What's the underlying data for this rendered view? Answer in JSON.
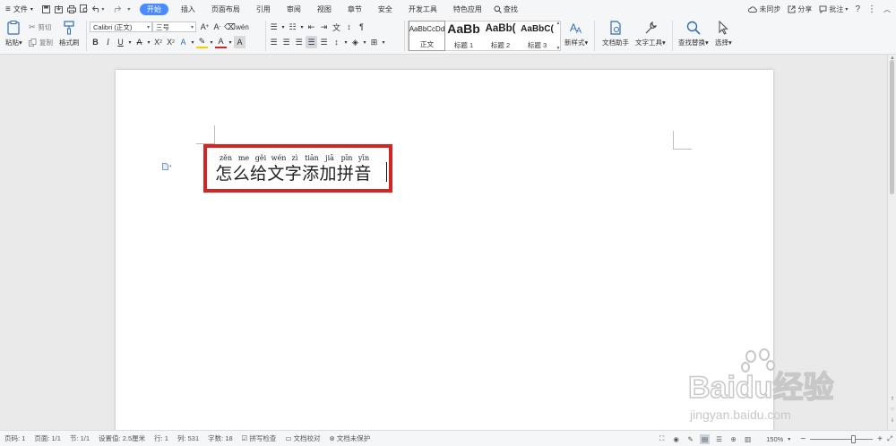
{
  "menubar": {
    "file_label": "文件",
    "tabs": [
      "开始",
      "插入",
      "页面布局",
      "引用",
      "审阅",
      "视图",
      "章节",
      "安全",
      "开发工具",
      "特色应用"
    ],
    "search_label": "查找",
    "sync_label": "未同步",
    "share_label": "分享",
    "comment_label": "批注",
    "help_label": "?"
  },
  "ribbon": {
    "paste_label": "粘贴",
    "cut_label": "剪切",
    "copy_label": "复制",
    "format_painter_label": "格式刷",
    "font_name": "Calibri (正文)",
    "font_size": "三号",
    "styles": [
      {
        "preview": "AaBbCcDd",
        "name": "正文"
      },
      {
        "preview": "AaBb",
        "name": "标题 1"
      },
      {
        "preview": "AaBb(",
        "name": "标题 2"
      },
      {
        "preview": "AaBbC(",
        "name": "标题 3"
      }
    ],
    "new_style_label": "新样式",
    "doc_assistant_label": "文档助手",
    "text_tools_label": "文字工具",
    "find_replace_label": "查找替换",
    "select_label": "选择"
  },
  "document": {
    "pinyin": [
      "zěn",
      "me",
      "gěi",
      "wén",
      "zì",
      "tiān",
      "jiā",
      "pīn",
      "yīn"
    ],
    "hanzi": [
      "怎",
      "么",
      "给",
      "文",
      "字",
      "添",
      "加",
      "拼",
      "音"
    ]
  },
  "status": {
    "page_num": "页码: 1",
    "pages": "页面: 1/1",
    "section": "节: 1/1",
    "setting": "设置值: 2.5厘米",
    "row": "行: 1",
    "col": "列: 531",
    "word_count": "字数: 18",
    "spell_check": "拼写检查",
    "proofread": "文档校对",
    "protection": "文档未保护",
    "zoom": "150%",
    "zoom_level": 0.7
  },
  "watermark": {
    "brand": "Baidu经验",
    "url": "jingyan.baidu.com"
  },
  "colors": {
    "accent": "#4a8cff",
    "highlight": "#d42525"
  }
}
